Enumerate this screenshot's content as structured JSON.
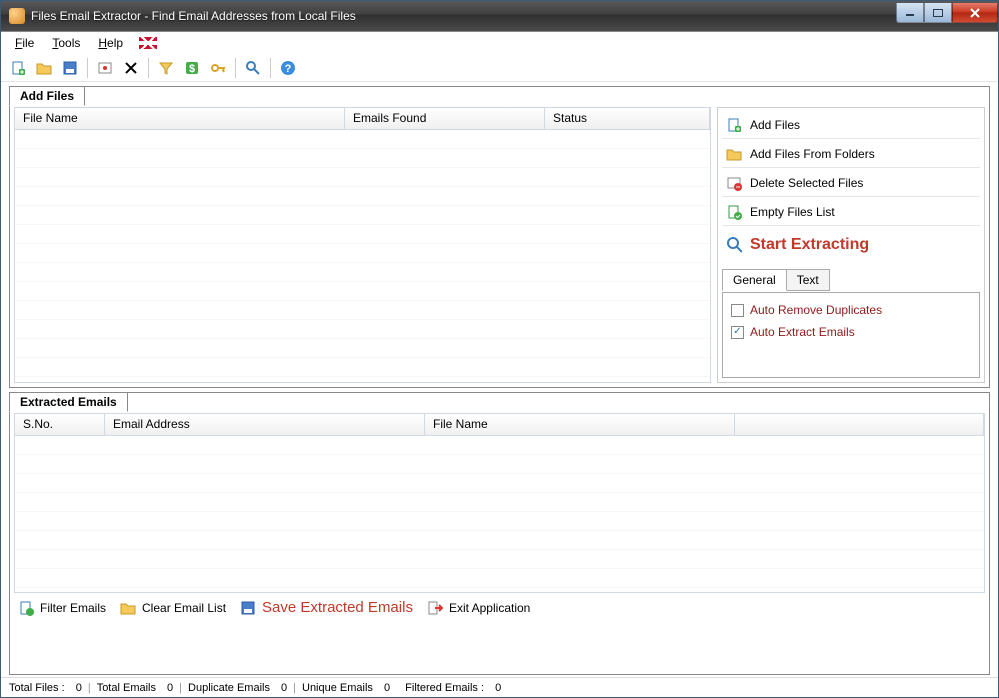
{
  "window": {
    "title": "Files Email Extractor -   Find Email Addresses from Local Files"
  },
  "menu": {
    "file": "File",
    "tools": "Tools",
    "help": "Help"
  },
  "toolbar_icons": {
    "add_file": "add-file-icon",
    "add_folder": "add-folder-icon",
    "save": "save-icon",
    "settings": "settings-icon",
    "delete": "delete-icon",
    "filter": "filter-icon",
    "dollar": "dollar-icon",
    "key": "key-icon",
    "search": "search-icon",
    "help": "help-icon"
  },
  "groups": {
    "add_files": "Add Files",
    "extracted": "Extracted Emails"
  },
  "file_table": {
    "cols": {
      "name": "File Name",
      "found": "Emails Found",
      "status": "Status"
    }
  },
  "side": {
    "add_files": "Add Files",
    "add_from_folders": "Add Files From Folders",
    "delete_selected": "Delete Selected Files",
    "empty_list": "Empty Files List",
    "start": "Start Extracting",
    "tabs": {
      "general": "General",
      "text": "Text"
    },
    "opt_remove_dup": "Auto Remove Duplicates",
    "opt_auto_extract": "Auto Extract Emails"
  },
  "email_table": {
    "cols": {
      "sno": "S.No.",
      "addr": "Email Address",
      "file": "File Name"
    }
  },
  "actions": {
    "filter": "Filter Emails",
    "clear": "Clear Email List",
    "save": "Save Extracted Emails",
    "exit": "Exit Application"
  },
  "status": {
    "total_files_lbl": "Total Files :",
    "total_files_val": "0",
    "total_emails_lbl": "Total Emails",
    "total_emails_val": "0",
    "dup_lbl": "Duplicate Emails",
    "dup_val": "0",
    "uniq_lbl": "Unique Emails",
    "uniq_val": "0",
    "filt_lbl": "Filtered Emails :",
    "filt_val": "0"
  }
}
